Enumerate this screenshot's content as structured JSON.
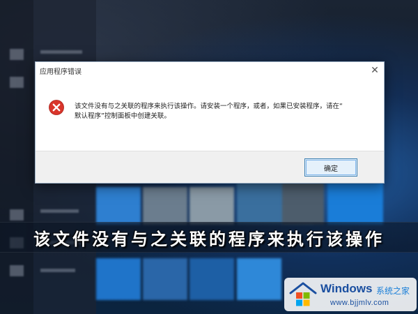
{
  "dialog": {
    "title": "应用程序错误",
    "close_glyph": "✕",
    "message_line1": "该文件没有与之关联的程序来执行该操作。请安装一个程序，或者，如果已安装程序，请在“",
    "message_line2": "默认程序”控制面板中创建关联。",
    "ok_label": "确定",
    "icon": "error-icon"
  },
  "caption": {
    "text": "该文件没有与之关联的程序来执行该操作"
  },
  "watermark": {
    "brand": "Windows",
    "subtitle": "系统之家",
    "url": "www.bjjmlv.com"
  },
  "colors": {
    "error_red": "#d9352b",
    "button_border": "#3c7fb1",
    "brand_blue": "#1a4fa0"
  }
}
